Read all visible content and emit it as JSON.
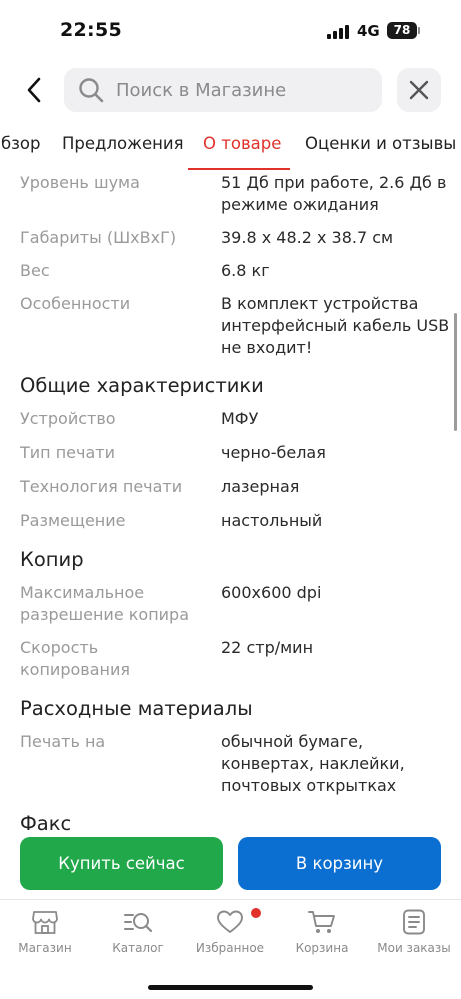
{
  "status_bar": {
    "time": "22:55",
    "network": "4G",
    "battery": "78"
  },
  "search": {
    "placeholder": "Поиск в Магазине"
  },
  "tabs": [
    {
      "label": "Обзор",
      "active": false
    },
    {
      "label": "Предложения",
      "active": false
    },
    {
      "label": "О товаре",
      "active": true
    },
    {
      "label": "Оценки и отзывы",
      "active": false
    }
  ],
  "specs": {
    "noise": {
      "label": "Уровень шума",
      "value": "51 Дб при работе, 2.6 Дб в режиме ожидания"
    },
    "dimensions": {
      "label": "Габариты (ШxВxГ)",
      "value": "39.8 x 48.2 x 38.7 см"
    },
    "weight": {
      "label": "Вес",
      "value": "6.8 кг"
    },
    "features": {
      "label": "Особенности",
      "value": "В комплект устройства интерфейсный кабель USB не входит!"
    },
    "general_title": "Общие характеристики",
    "device": {
      "label": "Устройство",
      "value": "МФУ"
    },
    "print_type": {
      "label": "Тип печати",
      "value": "черно-белая"
    },
    "print_tech": {
      "label": "Технология печати",
      "value": "лазерная"
    },
    "placement": {
      "label": "Размещение",
      "value": "настольный"
    },
    "copier_title": "Копир",
    "copy_resolution": {
      "label": "Максимальное разрешение копира",
      "value": "600x600 dpi"
    },
    "copy_speed": {
      "label": "Скорость копирования",
      "value": "22 стр/мин"
    },
    "consumables_title": "Расходные материалы",
    "print_on": {
      "label": "Печать на",
      "value": "обычной бумаге, конвертах, наклейки, почтовых открытках"
    },
    "fax_title": "Факс"
  },
  "actions": {
    "buy_now": "Купить сейчас",
    "add_to_cart": "В корзину"
  },
  "bottom_nav": [
    {
      "label": "Магазин",
      "icon": "store-icon"
    },
    {
      "label": "Каталог",
      "icon": "catalog-search-icon"
    },
    {
      "label": "Избранное",
      "icon": "heart-icon"
    },
    {
      "label": "Корзина",
      "icon": "cart-icon"
    },
    {
      "label": "Мои заказы",
      "icon": "orders-icon"
    }
  ],
  "colors": {
    "accent_red": "#e0312b",
    "buy_green": "#20a84a",
    "cart_blue": "#0a6fd0"
  }
}
